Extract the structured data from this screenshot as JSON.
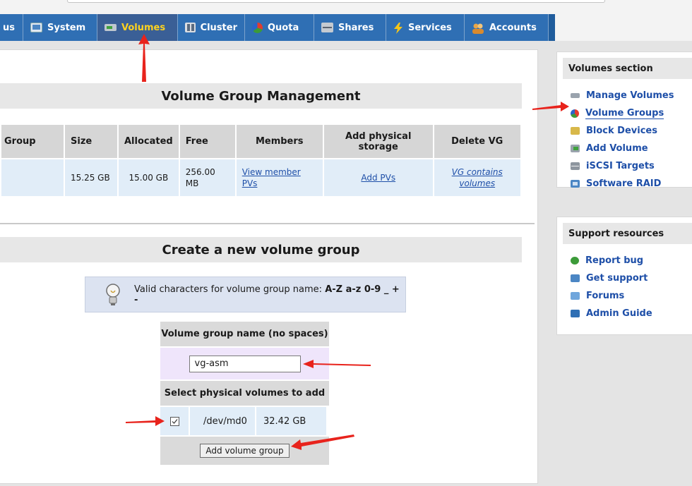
{
  "tabs": [
    {
      "label": "us",
      "icon": "status-icon"
    },
    {
      "label": "System",
      "icon": "monitor-icon"
    },
    {
      "label": "Volumes",
      "icon": "disk-icon",
      "active": true
    },
    {
      "label": "Cluster",
      "icon": "cluster-icon"
    },
    {
      "label": "Quota",
      "icon": "pie-icon"
    },
    {
      "label": "Shares",
      "icon": "shares-icon"
    },
    {
      "label": "Services",
      "icon": "bolt-icon"
    },
    {
      "label": "Accounts",
      "icon": "users-icon"
    }
  ],
  "vgm": {
    "title": "Volume Group Management",
    "headers": [
      "Group",
      "Size",
      "Allocated",
      "Free",
      "Members",
      "Add physical storage",
      "Delete VG"
    ],
    "row": {
      "group": "",
      "size": "15.25 GB",
      "allocated": "15.00 GB",
      "free": "256.00 MB",
      "members_link": "View member PVs",
      "add_pvs_link": "Add PVs",
      "delete_link": "VG contains volumes"
    }
  },
  "create": {
    "title": "Create a new volume group",
    "hint_prefix": "Valid characters for volume group name: ",
    "hint_chars": "A-Z a-z 0-9 _ + -",
    "name_header": "Volume group name (no spaces)",
    "name_value": "vg-asm",
    "pv_header": "Select physical volumes to add",
    "pv": {
      "device": "/dev/md0",
      "size": "32.42 GB",
      "checked": true
    },
    "submit_label": "Add volume group"
  },
  "sidebar": {
    "volumes_title": "Volumes section",
    "volumes_items": [
      {
        "label": "Manage Volumes",
        "icon": "drive-icon"
      },
      {
        "label": "Volume Groups",
        "icon": "pie-icon"
      },
      {
        "label": "Block Devices",
        "icon": "block-icon"
      },
      {
        "label": "Add Volume",
        "icon": "add-disk-icon"
      },
      {
        "label": "iSCSI Targets",
        "icon": "server-icon"
      },
      {
        "label": "Software RAID",
        "icon": "raid-icon"
      }
    ],
    "support_title": "Support resources",
    "support_items": [
      {
        "label": "Report bug",
        "icon": "bug-icon"
      },
      {
        "label": "Get support",
        "icon": "support-icon"
      },
      {
        "label": "Forums",
        "icon": "forum-icon"
      },
      {
        "label": "Admin Guide",
        "icon": "book-icon"
      }
    ]
  },
  "colors": {
    "tab_bar": "#2f6fb4",
    "tab_active_text": "#ffd21f",
    "link": "#1e4fa8",
    "annotation_arrow": "#e8231c"
  }
}
